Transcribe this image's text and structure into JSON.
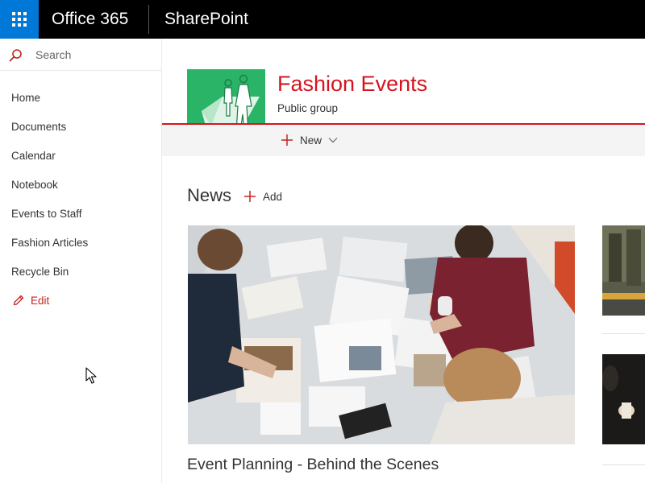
{
  "suite_bar": {
    "brand": "Office 365",
    "app_name": "SharePoint",
    "launcher_icon": "app-launcher-waffle-icon",
    "accent_color": "#0078d7"
  },
  "left_nav": {
    "search_placeholder": "Search",
    "items": [
      {
        "label": "Home"
      },
      {
        "label": "Documents"
      },
      {
        "label": "Calendar"
      },
      {
        "label": "Notebook"
      },
      {
        "label": "Events to Staff"
      },
      {
        "label": "Fashion Articles"
      },
      {
        "label": "Recycle Bin"
      }
    ],
    "edit_label": "Edit",
    "edit_icon": "pencil-icon",
    "edit_color": "#c5241f"
  },
  "site": {
    "title": "Fashion Events",
    "subtitle": "Public group",
    "logo_color": "#2ab467",
    "theme_color": "#d4151f"
  },
  "command_bar": {
    "new_label": "New",
    "new_icon": "plus-icon",
    "dropdown_icon": "chevron-down-icon"
  },
  "news": {
    "heading": "News",
    "add_label": "Add",
    "featured_caption": "Event Planning - Behind the Scenes"
  }
}
